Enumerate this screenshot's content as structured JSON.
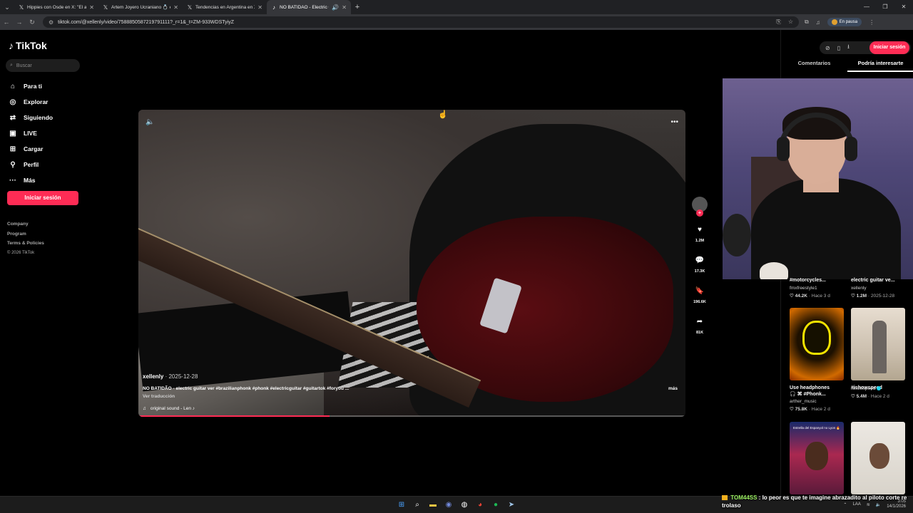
{
  "browser": {
    "tabs": [
      {
        "icon": "x-logo-icon",
        "title": "Hippies con Osde en X: \"El arte",
        "active": false
      },
      {
        "icon": "x-logo-icon",
        "title": "Artem Joyero Ucraniano 💍 en X",
        "active": false
      },
      {
        "icon": "x-logo-icon",
        "title": "Tendencias en Argentina en X",
        "active": false
      },
      {
        "icon": "tiktok-icon",
        "title": "NO BATIDÃO - Electric Guitar",
        "active": true
      }
    ],
    "url": "tiktok.com/@xellenly/video/7588850587219791111?_r=1&_t=ZM-933WDSTyiyZ",
    "profile_status": "En pausa"
  },
  "sidebar": {
    "brand": "TikTok",
    "search_placeholder": "Buscar",
    "nav": [
      {
        "label": "Para ti",
        "icon": "home-icon"
      },
      {
        "label": "Explorar",
        "icon": "compass-icon"
      },
      {
        "label": "Siguiendo",
        "icon": "following-icon"
      },
      {
        "label": "LIVE",
        "icon": "live-icon"
      },
      {
        "label": "Cargar",
        "icon": "upload-icon"
      },
      {
        "label": "Perfil",
        "icon": "profile-icon"
      },
      {
        "label": "Más",
        "icon": "more-icon"
      }
    ],
    "login_label": "Iniciar sesión",
    "footer": [
      "Company",
      "Program",
      "Terms & Policies"
    ],
    "copyright": "© 2026 TikTok"
  },
  "video": {
    "username": "xellenly",
    "date": "2025-12-28",
    "description": "NO BATIDÃO - electric guitar ver #brazilianphonk #phonk #electricguitar #guitartok #foryou ...",
    "more_label": "más",
    "translate_label": "Ver traducción",
    "sound": "original sound - Len ♪",
    "progress": 0.35
  },
  "actions": {
    "likes": "1.2M",
    "comments": "17.3K",
    "saves": "196.6K",
    "shares": "81K"
  },
  "right_panel": {
    "login_label": "Iniciar sesión",
    "tabs": [
      {
        "label": "Comentarios",
        "active": false
      },
      {
        "label": "Podría interesarte",
        "active": true
      }
    ],
    "cards_top": [
      {
        "title": "#motorcycles...",
        "author": "fmxfreestyle1",
        "likes": "44.2K",
        "age": "Hace 3 d"
      },
      {
        "title": "electric guitar ve...",
        "author": "xellenly",
        "likes": "1.2M",
        "age": "2025-12-28"
      }
    ],
    "cards_mid": [
      {
        "title": "Use headphones",
        "subtitle": "🎧 ⌘ #Phonk...",
        "author": "arther_music",
        "likes": "75.8K",
        "age": "Hace 2 d",
        "verified": false
      },
      {
        "title": "#ishowspeed",
        "subtitle": "",
        "author": "ishowspeed",
        "likes": "5.4M",
        "age": "Hace 2 d",
        "verified": true
      }
    ],
    "cards_bottom_banner": "Estrella del Espanyol no Lyon 🔥"
  },
  "chat": {
    "user": "TOM44SS",
    "message": "lo peor es que te imagine abrazadito al piloto corte re trolaso"
  },
  "taskbar": {
    "time": "3:05",
    "date": "14/1/2026",
    "lang": "LAA"
  }
}
